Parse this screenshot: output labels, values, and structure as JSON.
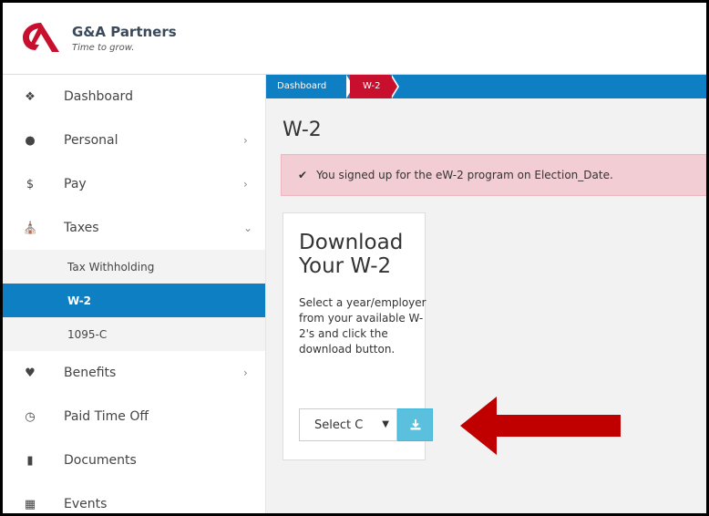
{
  "brand": {
    "name": "G&A Partners",
    "tagline": "Time to grow.",
    "color": "#c8102e"
  },
  "sidebar": {
    "items": [
      {
        "label": "Dashboard",
        "icon": "dashboard-icon"
      },
      {
        "label": "Personal",
        "icon": "user-icon"
      },
      {
        "label": "Pay",
        "icon": "dollar-icon"
      },
      {
        "label": "Taxes",
        "icon": "bank-icon"
      },
      {
        "label": "Benefits",
        "icon": "heartbeat-icon"
      },
      {
        "label": "Paid Time Off",
        "icon": "clock-icon"
      },
      {
        "label": "Documents",
        "icon": "document-icon"
      },
      {
        "label": "Events",
        "icon": "calendar-icon"
      }
    ],
    "taxes_sub": [
      {
        "label": "Tax Withholding"
      },
      {
        "label": "W-2"
      },
      {
        "label": "1095-C"
      }
    ]
  },
  "breadcrumb": {
    "items": [
      "Dashboard",
      "W-2"
    ]
  },
  "page": {
    "title": "W-2"
  },
  "alert": {
    "text": "You signed up for the eW-2 program on Election_Date."
  },
  "card": {
    "title": "Download Your W-2",
    "description": "Select a year/employer from your available W-2's and click the download button.",
    "select_value": "Select C"
  },
  "colors": {
    "primary": "#0f7fc4",
    "accent": "#c8102e",
    "alert_bg": "#f3cdd4",
    "button": "#5bc0de"
  }
}
